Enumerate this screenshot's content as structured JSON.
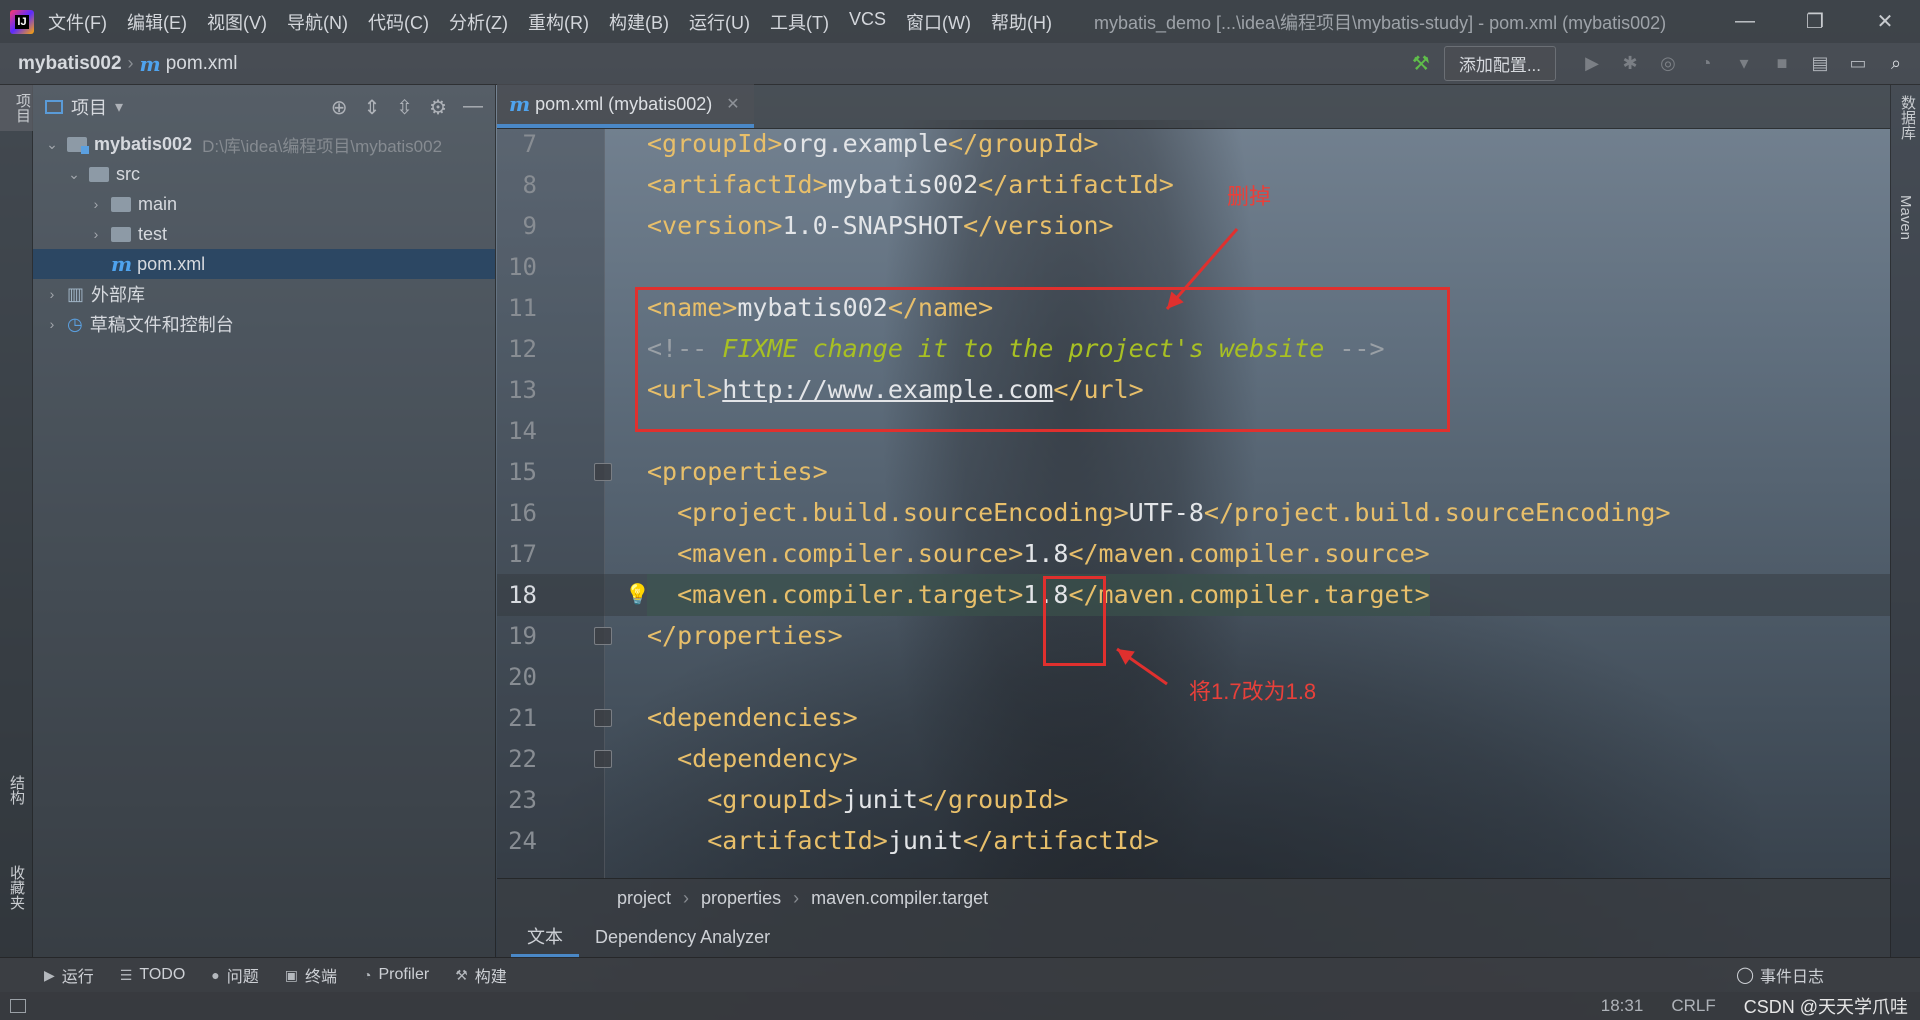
{
  "window": {
    "title": "mybatis_demo [...\\idea\\编程项目\\mybatis-study] - pom.xml (mybatis002)",
    "logo_text": "IJ",
    "controls": {
      "minimize": "—",
      "restore": "❐",
      "close": "✕"
    }
  },
  "menu": [
    "文件(F)",
    "编辑(E)",
    "视图(V)",
    "导航(N)",
    "代码(C)",
    "分析(Z)",
    "重构(R)",
    "构建(B)",
    "运行(U)",
    "工具(T)",
    "VCS",
    "窗口(W)",
    "帮助(H)"
  ],
  "navbar": {
    "project": "mybatis002",
    "file": "pom.xml",
    "m_icon": "m",
    "add_config_label": "添加配置..."
  },
  "left_stripe": {
    "project_tab": "项目",
    "structure_tab": "结构",
    "favorites_tab": "收藏夹"
  },
  "right_stripe": {
    "database_tab": "数据库",
    "maven_tab": "Maven"
  },
  "project_panel": {
    "title": "项目",
    "tree": [
      {
        "label": "mybatis002",
        "hint": "D:\\库\\idea\\编程项目\\mybatis002",
        "indent": 0,
        "expanded": true,
        "kind": "module"
      },
      {
        "label": "src",
        "indent": 1,
        "expanded": true,
        "kind": "folder"
      },
      {
        "label": "main",
        "indent": 2,
        "expanded": false,
        "kind": "folder"
      },
      {
        "label": "test",
        "indent": 2,
        "expanded": false,
        "kind": "folder"
      },
      {
        "label": "pom.xml",
        "indent": 2,
        "kind": "pom",
        "selected": true
      },
      {
        "label": "外部库",
        "indent": 0,
        "expanded": false,
        "kind": "library"
      },
      {
        "label": "草稿文件和控制台",
        "indent": 0,
        "expanded": false,
        "kind": "scratch"
      }
    ]
  },
  "editor": {
    "tab_label": "pom.xml (mybatis002)",
    "lines": [
      {
        "no": "7",
        "parts": [
          [
            "tag",
            "<groupId>"
          ],
          [
            "txt",
            "org.example"
          ],
          [
            "tag",
            "</groupId>"
          ]
        ]
      },
      {
        "no": "8",
        "parts": [
          [
            "tag",
            "<artifactId>"
          ],
          [
            "txt",
            "mybatis002"
          ],
          [
            "tag",
            "</artifactId>"
          ]
        ]
      },
      {
        "no": "9",
        "parts": [
          [
            "tag",
            "<version>"
          ],
          [
            "txt",
            "1.0-SNAPSHOT"
          ],
          [
            "tag",
            "</version>"
          ]
        ]
      },
      {
        "no": "10",
        "parts": []
      },
      {
        "no": "11",
        "parts": [
          [
            "tag",
            "<name>"
          ],
          [
            "txt",
            "mybatis002"
          ],
          [
            "tag",
            "</name>"
          ]
        ]
      },
      {
        "no": "12",
        "parts": [
          [
            "cmt",
            "<!-- "
          ],
          [
            "fix",
            "FIXME change it to the project's website"
          ],
          [
            "cmt",
            " -->"
          ]
        ]
      },
      {
        "no": "13",
        "parts": [
          [
            "tag",
            "<url>"
          ],
          [
            "url",
            "http://www.example.com"
          ],
          [
            "tag",
            "</url>"
          ]
        ]
      },
      {
        "no": "14",
        "parts": []
      },
      {
        "no": "15",
        "parts": [
          [
            "tag",
            "<properties>"
          ]
        ]
      },
      {
        "no": "16",
        "parts": [
          [
            "tag",
            "  <project.build.sourceEncoding>"
          ],
          [
            "txt",
            "UTF-8"
          ],
          [
            "tag",
            "</project.build.sourceEncoding>"
          ]
        ]
      },
      {
        "no": "17",
        "parts": [
          [
            "tag",
            "  <maven.compiler.source>"
          ],
          [
            "txt",
            "1.8"
          ],
          [
            "tag",
            "</maven.compiler.source>"
          ]
        ]
      },
      {
        "no": "18",
        "parts": [
          [
            "tag",
            "  <maven.compiler.target>"
          ],
          [
            "txt",
            "1.8"
          ],
          [
            "tag",
            "</maven.compiler.target>"
          ]
        ]
      },
      {
        "no": "19",
        "parts": [
          [
            "tag",
            "</properties>"
          ]
        ]
      },
      {
        "no": "20",
        "parts": []
      },
      {
        "no": "21",
        "parts": [
          [
            "tag",
            "<dependencies>"
          ]
        ]
      },
      {
        "no": "22",
        "parts": [
          [
            "tag",
            "  <dependency>"
          ]
        ]
      },
      {
        "no": "23",
        "parts": [
          [
            "tag",
            "    <groupId>"
          ],
          [
            "txt",
            "junit"
          ],
          [
            "tag",
            "</groupId>"
          ]
        ]
      },
      {
        "no": "24",
        "parts": [
          [
            "tag",
            "    <artifactId>"
          ],
          [
            "txt",
            "junit"
          ],
          [
            "tag",
            "</artifactId>"
          ]
        ]
      }
    ],
    "current_line": "18",
    "annotations": {
      "delete_label": "删掉",
      "change_label": "将1.7改为1.8"
    },
    "breadcrumbs": [
      "project",
      "properties",
      "maven.compiler.target"
    ],
    "bottom_tabs": [
      "文本",
      "Dependency Analyzer"
    ]
  },
  "tool_windows": [
    {
      "icon": "▶",
      "label": "运行"
    },
    {
      "icon": "☰",
      "label": "TODO"
    },
    {
      "icon": "●",
      "label": "问题"
    },
    {
      "icon": "▣",
      "label": "终端"
    },
    {
      "icon": "◔",
      "label": "Profiler"
    },
    {
      "icon": "⚒",
      "label": "构建"
    }
  ],
  "event_log_label": "事件日志",
  "status": {
    "position": "18:31",
    "line_sep": "CRLF",
    "watermark": "CSDN @天天学爪哇"
  },
  "colors": {
    "accent": "#4a88c7",
    "annotation": "#e0302e",
    "tag": "#e8bf6a",
    "fixme": "#a8c023"
  }
}
